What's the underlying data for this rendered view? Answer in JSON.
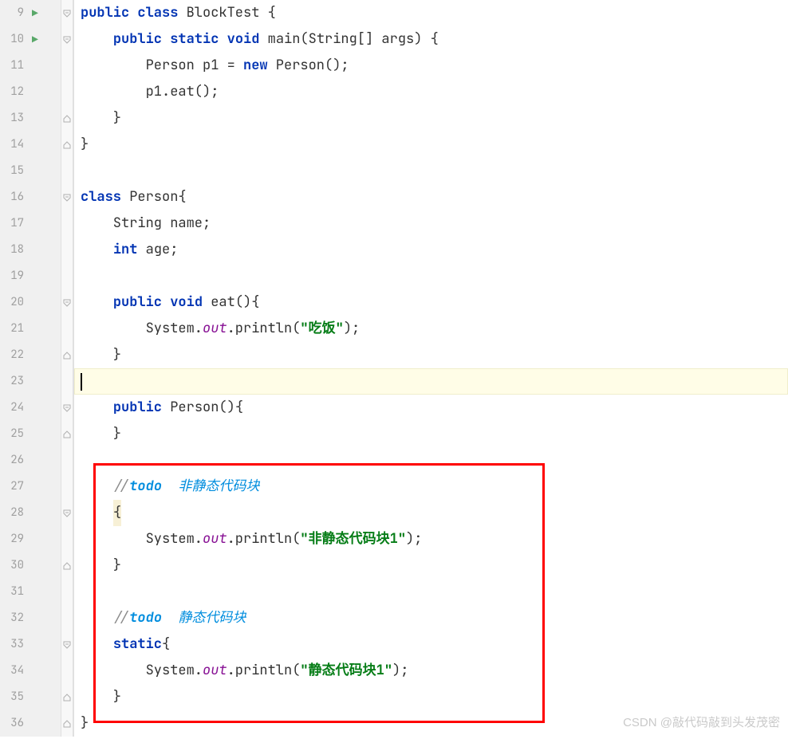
{
  "watermark": "CSDN @敲代码敲到头发茂密",
  "lines": [
    {
      "num": 9,
      "run": true,
      "fold": "open",
      "tokens": [
        [
          "kw",
          "public"
        ],
        [
          "",
          " "
        ],
        [
          "kw",
          "class"
        ],
        [
          "",
          " BlockTest {"
        ]
      ]
    },
    {
      "num": 10,
      "run": true,
      "fold": "open",
      "tokens": [
        [
          "",
          "    "
        ],
        [
          "kw",
          "public"
        ],
        [
          "",
          " "
        ],
        [
          "kw",
          "static"
        ],
        [
          "",
          " "
        ],
        [
          "kw",
          "void"
        ],
        [
          "",
          " main(String[] args) {"
        ]
      ]
    },
    {
      "num": 11,
      "run": false,
      "fold": "",
      "tokens": [
        [
          "",
          "        Person p1 = "
        ],
        [
          "kw",
          "new"
        ],
        [
          "",
          " Person();"
        ]
      ]
    },
    {
      "num": 12,
      "run": false,
      "fold": "",
      "tokens": [
        [
          "",
          "        p1.eat();"
        ]
      ]
    },
    {
      "num": 13,
      "run": false,
      "fold": "close",
      "tokens": [
        [
          "",
          "    }"
        ]
      ]
    },
    {
      "num": 14,
      "run": false,
      "fold": "close",
      "tokens": [
        [
          "",
          "}"
        ]
      ]
    },
    {
      "num": 15,
      "run": false,
      "fold": "",
      "tokens": [
        [
          "",
          ""
        ]
      ]
    },
    {
      "num": 16,
      "run": false,
      "fold": "open",
      "tokens": [
        [
          "kw",
          "class"
        ],
        [
          "",
          " Person{"
        ]
      ]
    },
    {
      "num": 17,
      "run": false,
      "fold": "",
      "tokens": [
        [
          "",
          "    String name;"
        ]
      ]
    },
    {
      "num": 18,
      "run": false,
      "fold": "",
      "tokens": [
        [
          "",
          "    "
        ],
        [
          "kw",
          "int"
        ],
        [
          "",
          " age;"
        ]
      ]
    },
    {
      "num": 19,
      "run": false,
      "fold": "",
      "tokens": [
        [
          "",
          ""
        ]
      ]
    },
    {
      "num": 20,
      "run": false,
      "fold": "open",
      "tokens": [
        [
          "",
          "    "
        ],
        [
          "kw",
          "public"
        ],
        [
          "",
          " "
        ],
        [
          "kw",
          "void"
        ],
        [
          "",
          " eat(){"
        ]
      ]
    },
    {
      "num": 21,
      "run": false,
      "fold": "",
      "tokens": [
        [
          "",
          "        System."
        ],
        [
          "fld",
          "out"
        ],
        [
          "",
          ".println("
        ],
        [
          "str",
          "\"吃饭\""
        ],
        [
          "",
          ");"
        ]
      ]
    },
    {
      "num": 22,
      "run": false,
      "fold": "close",
      "tokens": [
        [
          "",
          "    }"
        ]
      ]
    },
    {
      "num": 23,
      "run": false,
      "fold": "",
      "active": true,
      "tokens": []
    },
    {
      "num": 24,
      "run": false,
      "fold": "open",
      "tokens": [
        [
          "",
          "    "
        ],
        [
          "kw",
          "public"
        ],
        [
          "",
          " Person(){"
        ]
      ]
    },
    {
      "num": 25,
      "run": false,
      "fold": "close",
      "tokens": [
        [
          "",
          "    }"
        ]
      ]
    },
    {
      "num": 26,
      "run": false,
      "fold": "",
      "tokens": [
        [
          "",
          ""
        ]
      ]
    },
    {
      "num": 27,
      "run": false,
      "fold": "",
      "tokens": [
        [
          "",
          "    "
        ],
        [
          "cmt",
          "//"
        ],
        [
          "todo",
          "todo"
        ],
        [
          "todo-txt",
          "  非静态代码块"
        ]
      ]
    },
    {
      "num": 28,
      "run": false,
      "fold": "open",
      "tokens": [
        [
          "",
          "    "
        ],
        [
          "warn",
          "{"
        ]
      ]
    },
    {
      "num": 29,
      "run": false,
      "fold": "",
      "tokens": [
        [
          "",
          "        System."
        ],
        [
          "fld",
          "out"
        ],
        [
          "",
          ".println("
        ],
        [
          "str",
          "\"非静态代码块1\""
        ],
        [
          "",
          ");"
        ]
      ]
    },
    {
      "num": 30,
      "run": false,
      "fold": "close",
      "tokens": [
        [
          "",
          "    }"
        ]
      ]
    },
    {
      "num": 31,
      "run": false,
      "fold": "",
      "tokens": [
        [
          "",
          ""
        ]
      ]
    },
    {
      "num": 32,
      "run": false,
      "fold": "",
      "tokens": [
        [
          "",
          "    "
        ],
        [
          "cmt",
          "//"
        ],
        [
          "todo",
          "todo"
        ],
        [
          "todo-txt",
          "  静态代码块"
        ]
      ]
    },
    {
      "num": 33,
      "run": false,
      "fold": "open",
      "tokens": [
        [
          "",
          "    "
        ],
        [
          "kw",
          "static"
        ],
        [
          "",
          "{"
        ]
      ]
    },
    {
      "num": 34,
      "run": false,
      "fold": "",
      "tokens": [
        [
          "",
          "        System."
        ],
        [
          "fld",
          "out"
        ],
        [
          "",
          ".println("
        ],
        [
          "str",
          "\"静态代码块1\""
        ],
        [
          "",
          ");"
        ]
      ]
    },
    {
      "num": 35,
      "run": false,
      "fold": "close",
      "tokens": [
        [
          "",
          "    }"
        ]
      ]
    },
    {
      "num": 36,
      "run": false,
      "fold": "close",
      "tokens": [
        [
          "",
          "}"
        ]
      ]
    }
  ]
}
